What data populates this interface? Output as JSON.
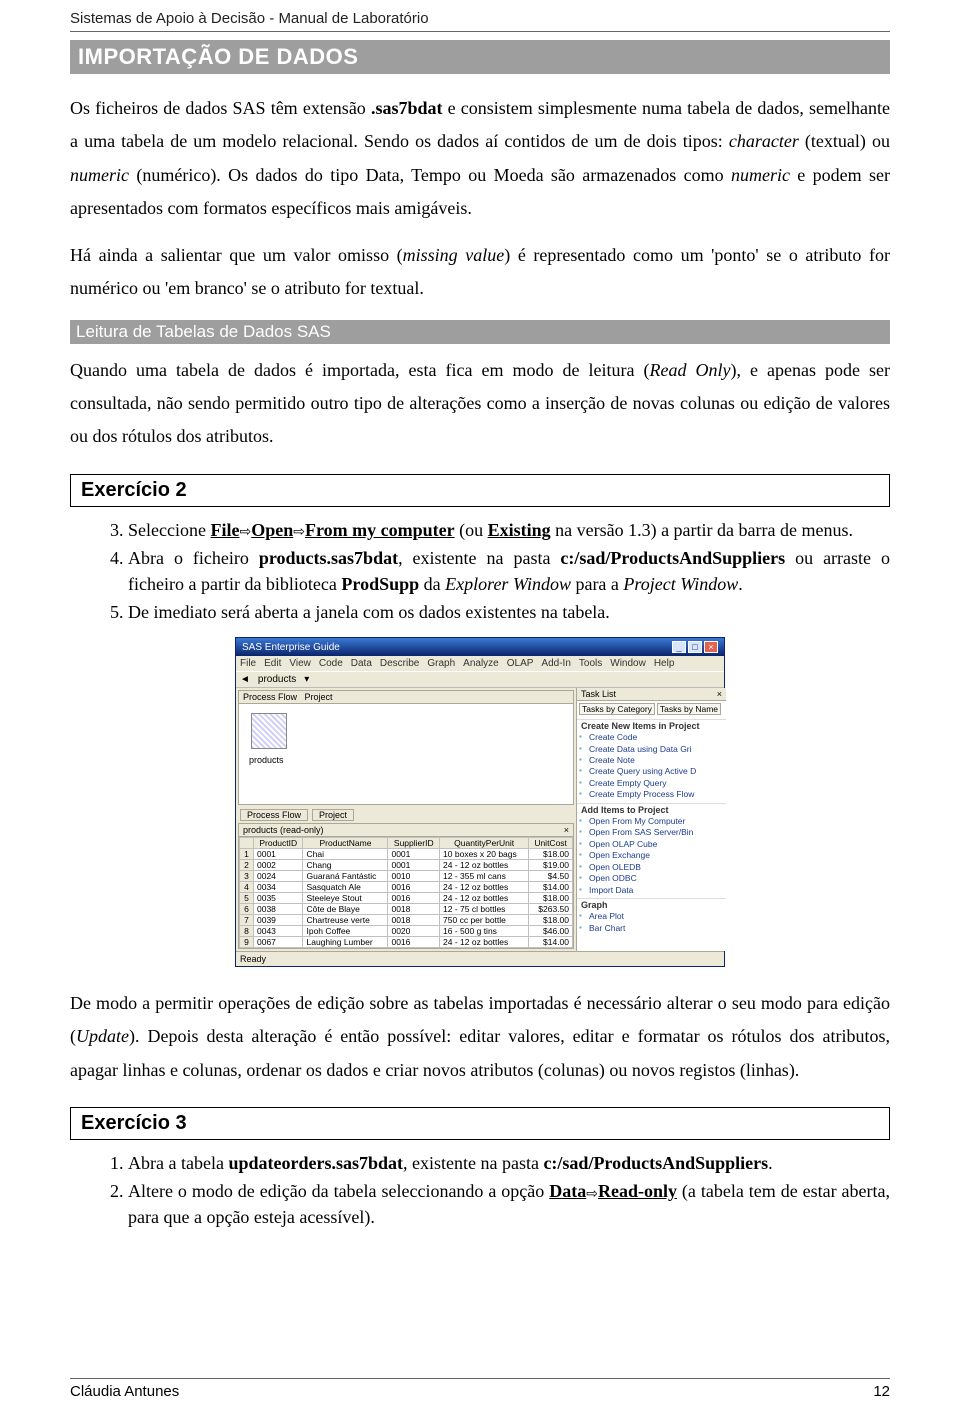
{
  "header": "Sistemas de Apoio à Decisão - Manual de Laboratório",
  "band": "IMPORTAÇÃO DE DADOS",
  "para1_a": "Os ficheiros de dados SAS têm extensão ",
  "para1_b": ".sas7bdat",
  "para1_c": " e consistem simplesmente numa tabela de dados, semelhante a uma tabela de um modelo relacional. Sendo os dados aí contidos de um de dois tipos: ",
  "para1_d": "character",
  "para1_e": " (textual) ou ",
  "para1_f": "numeric",
  "para1_g": " (numérico). Os dados do tipo Data, Tempo ou Moeda são armazenados como ",
  "para1_h": "numeric",
  "para1_i": " e podem ser apresentados com formatos específicos mais amigáveis.",
  "para2_a": "Há ainda a salientar que um valor omisso (",
  "para2_b": "missing value",
  "para2_c": ") é representado como um 'ponto' se o atributo for numérico ou 'em branco' se o atributo for textual.",
  "subband": "Leitura de Tabelas de Dados SAS",
  "para3_a": "Quando uma tabela de dados é importada, esta fica em modo de leitura (",
  "para3_b": "Read Only",
  "para3_c": "), e apenas pode ser consultada, não sendo permitido outro tipo de alterações como a inserção de novas colunas ou edição de valores ou dos rótulos dos atributos.",
  "ex2_title": "Exercício 2",
  "ex2": {
    "i3a": "Seleccione ",
    "i3b": "File",
    "i3c": "Open",
    "i3d": "From my computer",
    "i3e": " (ou ",
    "i3f": "Existing",
    "i3g": " na versão 1.3) a partir da barra de menus.",
    "i4a": "Abra o ficheiro ",
    "i4b": "products.sas7bdat",
    "i4c": ", existente na pasta ",
    "i4d": "c:/sad/ProductsAndSuppliers",
    "i4e": " ou arraste o ficheiro a partir da biblioteca ",
    "i4f": "ProdSupp",
    "i4g": " da ",
    "i4h": "Explorer Window",
    "i4i": " para a ",
    "i4j": "Project Window",
    "i4k": ".",
    "i5": "De imediato será aberta a janela com os dados existentes na tabela."
  },
  "para4_a": "De modo a permitir operações de edição sobre as tabelas importadas é necessário alterar o seu modo para edição (",
  "para4_b": "Update",
  "para4_c": "). Depois desta alteração é então possível: editar valores, editar e formatar os rótulos dos atributos, apagar linhas e colunas, ordenar os dados e criar novos atributos (colunas) ou novos registos (linhas).",
  "ex3_title": "Exercício 3",
  "ex3": {
    "i1a": "Abra a tabela ",
    "i1b": "updateorders.sas7bdat",
    "i1c": ", existente na pasta ",
    "i1d": "c:/sad/ProductsAndSuppliers",
    "i1e": ".",
    "i2a": "Altere o modo de edição da tabela seleccionando a opção ",
    "i2b": "Data",
    "i2c": "Read-only",
    "i2d": " (a tabela tem de estar aberta, para que a opção esteja acessível)."
  },
  "footer_left": "Cláudia Antunes",
  "footer_right": "12",
  "arrow": "⇨",
  "app": {
    "title": "SAS Enterprise Guide",
    "menus": [
      "File",
      "Edit",
      "View",
      "Code",
      "Data",
      "Describe",
      "Graph",
      "Analyze",
      "OLAP",
      "Add-In",
      "Tools",
      "Window",
      "Help"
    ],
    "breadcrumb": "products",
    "flow_header": "Process Flow",
    "project_tab": "Project",
    "flow_icon": "products",
    "tabs": [
      "Process Flow",
      "Project"
    ],
    "grid_title": "products (read-only)",
    "columns": [
      "",
      "ProductID",
      "ProductName",
      "SupplierID",
      "QuantityPerUnit",
      "UnitCost"
    ],
    "rows": [
      [
        "1",
        "0001",
        "Chai",
        "0001",
        "10 boxes x 20 bags",
        "$18.00"
      ],
      [
        "2",
        "0002",
        "Chang",
        "0001",
        "24 - 12 oz bottles",
        "$19.00"
      ],
      [
        "3",
        "0024",
        "Guaraná Fantástic",
        "0010",
        "12 - 355 ml cans",
        "$4.50"
      ],
      [
        "4",
        "0034",
        "Sasquatch Ale",
        "0016",
        "24 - 12 oz bottles",
        "$14.00"
      ],
      [
        "5",
        "0035",
        "Steeleye Stout",
        "0016",
        "24 - 12 oz bottles",
        "$18.00"
      ],
      [
        "6",
        "0038",
        "Côte de Blaye",
        "0018",
        "12 - 75 cl bottles",
        "$263.50"
      ],
      [
        "7",
        "0039",
        "Chartreuse verte",
        "0018",
        "750 cc per bottle",
        "$18.00"
      ],
      [
        "8",
        "0043",
        "Ipoh Coffee",
        "0020",
        "16 - 500 g tins",
        "$46.00"
      ],
      [
        "9",
        "0067",
        "Laughing Lumber",
        "0016",
        "24 - 12 oz bottles",
        "$14.00"
      ]
    ],
    "tasklist": "Task List",
    "tasktabs": [
      "Tasks by Category",
      "Tasks by Name"
    ],
    "sec1": "Create New Items in Project",
    "sec1_items": [
      "Create Code",
      "Create Data using Data Gri",
      "Create Note",
      "Create Query using Active D",
      "Create Empty Query",
      "Create Empty Process Flow"
    ],
    "sec2": "Add Items to Project",
    "sec2_items": [
      "Open From My Computer",
      "Open From SAS Server/Bin",
      "Open OLAP Cube",
      "Open Exchange",
      "Open OLEDB",
      "Open ODBC",
      "Import Data"
    ],
    "sec3": "Graph",
    "sec3_items": [
      "Area Plot",
      "Bar Chart"
    ],
    "status": "Ready"
  }
}
